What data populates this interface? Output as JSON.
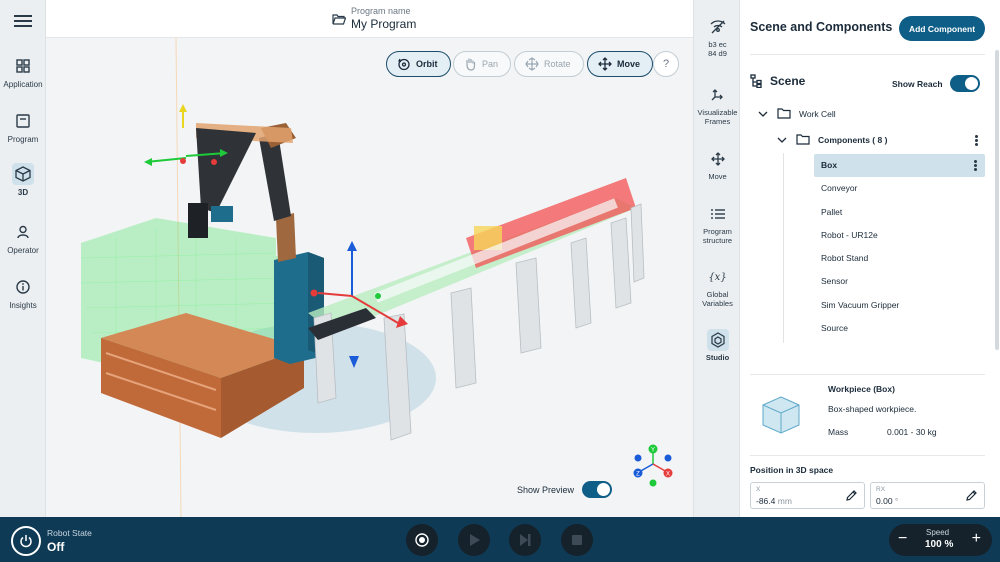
{
  "header": {
    "program_label": "Program name",
    "program_name": "My Program"
  },
  "left_nav": {
    "items": [
      {
        "label": "Application",
        "icon": "grid-icon"
      },
      {
        "label": "Program",
        "icon": "program-icon"
      },
      {
        "label": "3D",
        "icon": "cube-icon",
        "active": true
      },
      {
        "label": "Operator",
        "icon": "person-icon"
      },
      {
        "label": "Insights",
        "icon": "info-icon"
      }
    ]
  },
  "viewport": {
    "buttons": {
      "orbit": "Orbit",
      "pan": "Pan",
      "rotate": "Rotate",
      "move": "Move",
      "help": "?"
    },
    "show_preview_label": "Show Preview",
    "show_preview_on": true,
    "axis_labels": {
      "y": "Y",
      "z": "Z",
      "x": "X"
    }
  },
  "tool_rail": {
    "items": [
      {
        "label": "b3 ec 84 d9",
        "icon": "signal-icon"
      },
      {
        "label": "Visualizable Frames",
        "icon": "frames-icon"
      },
      {
        "label": "Move",
        "icon": "move-icon"
      },
      {
        "label": "Program structure",
        "icon": "list-icon"
      },
      {
        "label": "Global Variables",
        "icon": "variables-icon"
      },
      {
        "label": "Studio",
        "icon": "studio-icon",
        "active": true
      }
    ]
  },
  "panel": {
    "title": "Scene and Components",
    "add_button": "Add Component",
    "scene_title": "Scene",
    "show_reach_label": "Show Reach",
    "show_reach_on": true,
    "work_cell": "Work Cell",
    "components_label": "Components ( 8 )",
    "components": [
      "Box",
      "Conveyor",
      "Pallet",
      "Robot - UR12e",
      "Robot Stand",
      "Sensor",
      "Sim Vacuum Gripper",
      "Source"
    ],
    "selected": "Box",
    "workpiece": {
      "title": "Workpiece (Box)",
      "description": "Box-shaped workpiece.",
      "mass_label": "Mass",
      "mass_value": "0.001 - 30 kg"
    },
    "position": {
      "title": "Position in 3D space",
      "x_label": "X",
      "x_value": "-86.4",
      "x_unit": "mm",
      "rx_label": "RX",
      "rx_value": "0.00",
      "rx_unit": "°"
    }
  },
  "bottom": {
    "robot_state_label": "Robot State",
    "robot_state_value": "Off",
    "speed_label": "Speed",
    "speed_value": "100 %",
    "minus": "−",
    "plus": "+"
  },
  "colors": {
    "accent": "#0f5e87",
    "bottom_bar": "#0f3a55",
    "selection": "#cfe1ea"
  }
}
